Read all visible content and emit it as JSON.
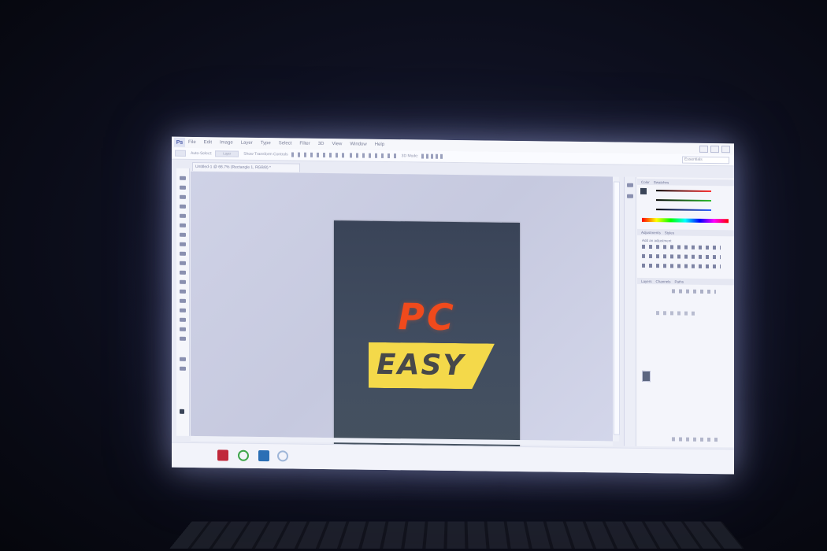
{
  "app": {
    "logo_text": "Ps",
    "menu": [
      "File",
      "Edit",
      "Image",
      "Layer",
      "Type",
      "Select",
      "Filter",
      "3D",
      "View",
      "Window",
      "Help"
    ]
  },
  "options_bar": {
    "auto_select_label": "Auto-Select:",
    "auto_select_value": "Layer",
    "transform_controls_label": "Show Transform Controls",
    "mode_label": "3D Mode:",
    "workspace": "Essentials"
  },
  "document": {
    "tab_label": "Untitled-1 @ 66.7% (Rectangle 1, RGB/8) *"
  },
  "artwork": {
    "pc_text": "PC",
    "easy_text": "EASY",
    "pc_color": "#f04a1c",
    "banner_color": "#f4d94a",
    "easy_color": "#47484a",
    "canvas_color": "#414d60"
  },
  "panels": {
    "color_tabs": [
      "Color",
      "Swatches"
    ],
    "adjust_tabs": [
      "Adjustments",
      "Styles"
    ],
    "adjust_hint": "Add an adjustment",
    "layer_tabs": [
      "Layers",
      "Channels",
      "Paths"
    ]
  },
  "taskbar": {
    "icons": [
      "app-icon-red",
      "chrome-icon",
      "photoshop-icon",
      "loading-icon"
    ],
    "time": "",
    "date": ""
  }
}
